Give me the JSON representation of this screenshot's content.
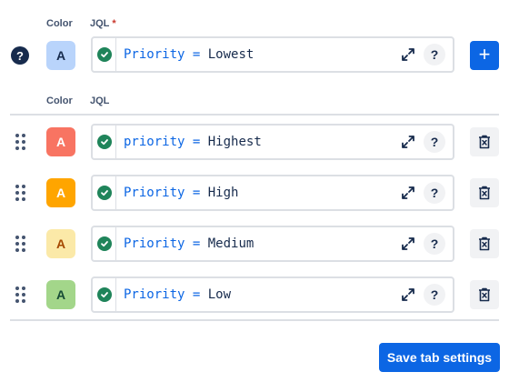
{
  "new_rule": {
    "color_label": "Color",
    "jql_label": "JQL",
    "required_mark": "*",
    "help_icon": "?",
    "swatch_letter": "A",
    "swatch_bg": "#b9d4fb",
    "swatch_fg": "#172b4d",
    "jql_field": "Priority",
    "jql_operator": "=",
    "jql_value": "Lowest",
    "jql_help": "?",
    "add_label": "+"
  },
  "list_header": {
    "color_label": "Color",
    "jql_label": "JQL"
  },
  "rules": [
    {
      "swatch_letter": "A",
      "swatch_bg": "#f87462",
      "swatch_fg": "#ffffff",
      "jql_field": "priority",
      "jql_operator": "=",
      "jql_value": "Highest",
      "jql_help": "?"
    },
    {
      "swatch_letter": "A",
      "swatch_bg": "#ffa500",
      "swatch_fg": "#ffffff",
      "jql_field": "Priority",
      "jql_operator": "=",
      "jql_value": "High",
      "jql_help": "?"
    },
    {
      "swatch_letter": "A",
      "swatch_bg": "#fbe9a8",
      "swatch_fg": "#a54800",
      "jql_field": "Priority",
      "jql_operator": "=",
      "jql_value": "Medium",
      "jql_help": "?"
    },
    {
      "swatch_letter": "A",
      "swatch_bg": "#a3d68a",
      "swatch_fg": "#164b35",
      "jql_field": "Priority",
      "jql_operator": "=",
      "jql_value": "Low",
      "jql_help": "?"
    }
  ],
  "save_label": "Save tab settings",
  "colors": {
    "accent": "#0c66e4",
    "valid": "#1f845a"
  }
}
